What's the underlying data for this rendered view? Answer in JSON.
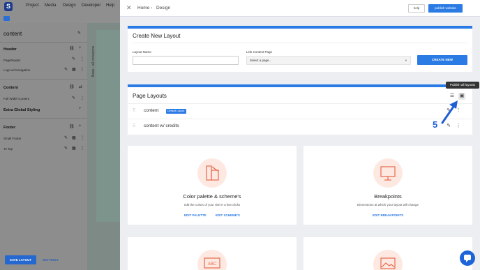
{
  "topnav": {
    "items": [
      "Project",
      "Media",
      "Design",
      "Developer",
      "Help"
    ]
  },
  "panel": {
    "canvas_label": "Base - all inclusions",
    "title": "content",
    "sections": [
      {
        "name": "Header",
        "rows": [
          "Pageheader",
          "Logo w/ Navigation"
        ]
      },
      {
        "name": "Content",
        "rows": [
          "Full Width Content"
        ]
      },
      {
        "name": "Extra Global Styling",
        "rows": []
      },
      {
        "name": "Footer",
        "rows": [
          "Small Footer",
          "To Top"
        ]
      }
    ],
    "save_label": "SAVE LAYOUT",
    "settings_label": "SETTINGS"
  },
  "header": {
    "breadcrumb": [
      "Home",
      "Design"
    ],
    "help_label": "help",
    "publish_label": "publish website"
  },
  "create_layout": {
    "title": "Create New Layout",
    "layout_name_label": "Layout Name",
    "link_label": "Link Content Page",
    "select_placeholder": "Select a page...",
    "create_label": "CREATE NEW"
  },
  "page_layouts": {
    "title": "Page Layouts",
    "tooltip": "Publish all layouts",
    "rows": [
      {
        "name": "content",
        "badge": "Default Layout"
      },
      {
        "name": "content w/ credits",
        "badge": ""
      }
    ],
    "annotation_number": "5"
  },
  "tiles": [
    {
      "title": "Color palette & scheme's",
      "desc": "edit the colors of your site in a few clicks",
      "links": [
        "EDIT PALETTE",
        "EDIT SCHEME'S"
      ]
    },
    {
      "title": "Breakpoints",
      "desc": "Dimensions at which your layout will change",
      "links": [
        "EDIT BREAKPOINTS"
      ]
    }
  ],
  "colors": {
    "accent": "#2b7be4",
    "tile_icon_bg": "#fde9e2",
    "tile_icon_fg": "#e86a4c"
  }
}
